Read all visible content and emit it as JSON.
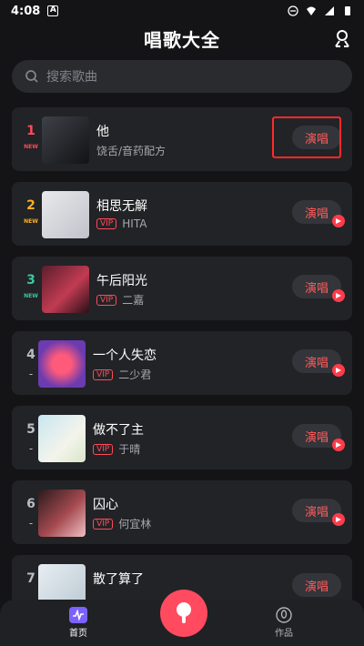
{
  "status": {
    "time": "4:08",
    "badge": "A"
  },
  "header": {
    "title": "唱歌大全"
  },
  "search": {
    "placeholder": "搜索歌曲"
  },
  "actions": {
    "sing_label": "演唱",
    "vip_label": "VIP"
  },
  "songs": [
    {
      "rank": "1",
      "badge": "NEW",
      "title": "他",
      "artist": "饶舌/音药配方",
      "vip": false,
      "highlighted": true,
      "rank_color": "#ff4a5a"
    },
    {
      "rank": "2",
      "badge": "NEW",
      "title": "相思无解",
      "artist": "HITA",
      "vip": true,
      "rank_color": "#ffb020"
    },
    {
      "rank": "3",
      "badge": "NEW",
      "title": "午后阳光",
      "artist": "二嘉",
      "vip": true,
      "rank_color": "#3cc6a0"
    },
    {
      "rank": "4",
      "badge": "-",
      "title": "一个人失恋",
      "artist": "二少君",
      "vip": true,
      "rank_color": "#b9bcc2"
    },
    {
      "rank": "5",
      "badge": "-",
      "title": "做不了主",
      "artist": "于晴",
      "vip": true,
      "rank_color": "#b9bcc2"
    },
    {
      "rank": "6",
      "badge": "-",
      "title": "囚心",
      "artist": "何宜林",
      "vip": true,
      "rank_color": "#b9bcc2"
    },
    {
      "rank": "7",
      "badge": "",
      "title": "散了算了",
      "artist": "",
      "vip": false,
      "rank_color": "#b9bcc2"
    }
  ],
  "nav": {
    "home_label": "首页",
    "works_label": "作品"
  },
  "colors": {
    "accent": "#ff4a5a",
    "background": "#141416",
    "card": "#222326"
  }
}
